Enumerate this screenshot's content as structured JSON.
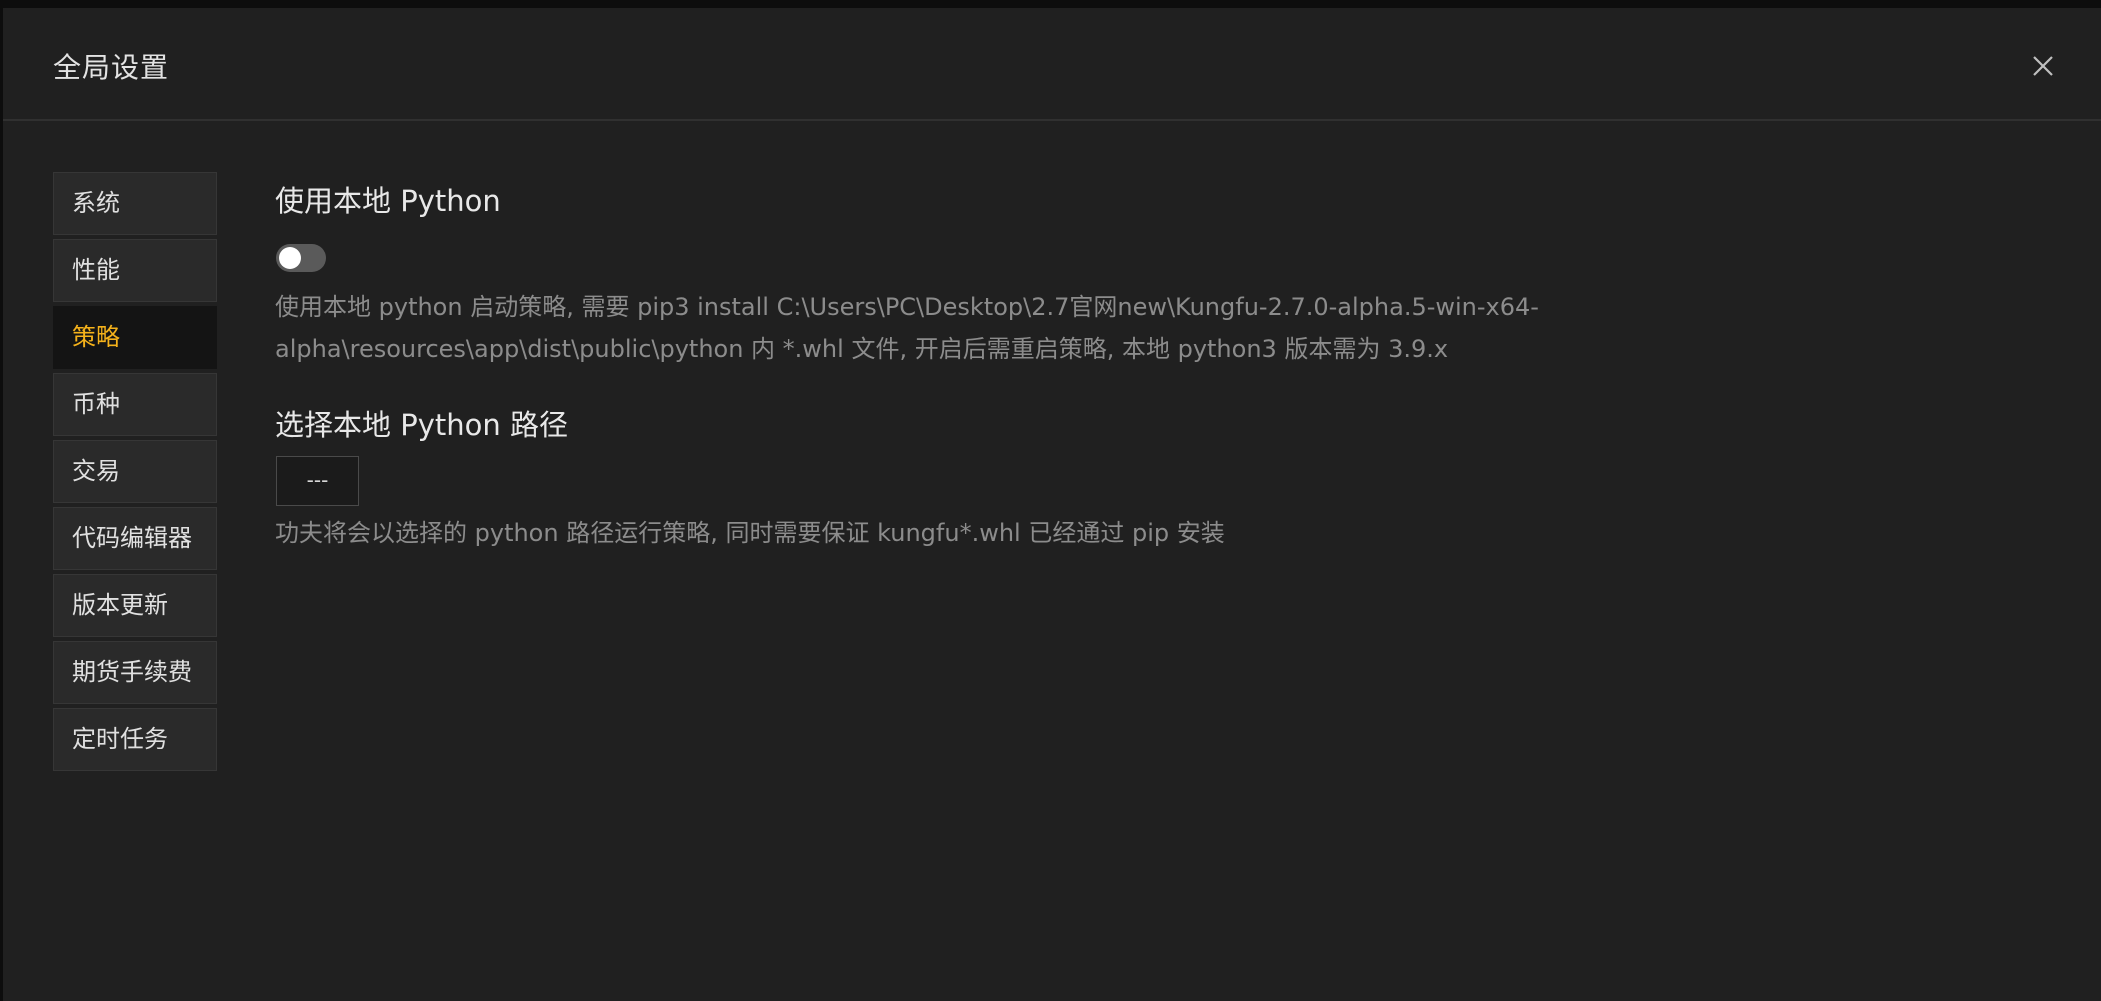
{
  "modal": {
    "title": "全局设置"
  },
  "sidebar": {
    "items": [
      {
        "label": "系统"
      },
      {
        "label": "性能"
      },
      {
        "label": "策略"
      },
      {
        "label": "币种"
      },
      {
        "label": "交易"
      },
      {
        "label": "代码编辑器"
      },
      {
        "label": "版本更新"
      },
      {
        "label": "期货手续费"
      },
      {
        "label": "定时任务"
      }
    ],
    "active_item": "策略"
  },
  "settings": {
    "use_local_python": {
      "title": "使用本地 Python",
      "enabled": false,
      "description_line1": "使用本地 python 启动策略, 需要 pip3 install C:\\Users\\PC\\Desktop\\2.7官网new\\Kungfu-2.7.0-alpha.5-win-x64-",
      "description_line2": "alpha\\resources\\app\\dist\\public\\python 内 *.whl 文件, 开启后需重启策略, 本地 python3 版本需为 3.9.x"
    },
    "python_path": {
      "title": "选择本地 Python 路径",
      "button_label": "---",
      "description": "功夫将会以选择的 python 路径运行策略, 同时需要保证 kungfu*.whl 已经通过 pip 安装"
    }
  },
  "colors": {
    "accent": "#f5b21b",
    "background": "#202020"
  }
}
